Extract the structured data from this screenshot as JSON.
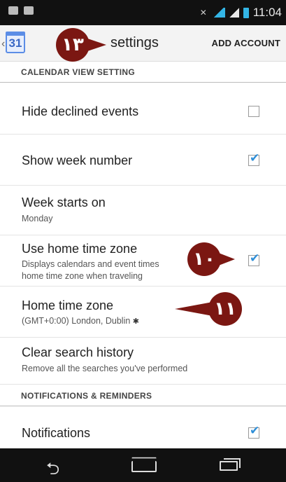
{
  "status_bar": {
    "time": "11:04"
  },
  "action_bar": {
    "app_icon_text": "31",
    "title": "settings",
    "add_account": "ADD ACCOUNT"
  },
  "sections": [
    {
      "header": "CALENDAR VIEW SETTING"
    },
    {
      "header": "NOTIFICATIONS & REMINDERS"
    }
  ],
  "rows": [
    {
      "title": "Hide declined events",
      "checked": false
    },
    {
      "title": "Show week number",
      "checked": true
    },
    {
      "title": "Week starts on",
      "subtitle": "Monday"
    },
    {
      "title": "Use home time zone",
      "subtitle_line1": "Displays calendars and event times",
      "subtitle_line2": "home time zone when traveling",
      "checked": true
    },
    {
      "title": "Home time zone",
      "subtitle": "(GMT+0:00) London, Dublin",
      "marker": "✱"
    },
    {
      "title": "Clear search history",
      "subtitle": "Remove all the searches you've performed"
    },
    {
      "title": "Notifications",
      "checked": true
    }
  ],
  "callouts": [
    {
      "label": "١٣"
    },
    {
      "label": "١٠"
    },
    {
      "label": "١١"
    }
  ],
  "icons": {
    "back": "back-icon",
    "home": "home-icon",
    "recents": "recents-icon"
  },
  "colors": {
    "callout": "#7b1712",
    "checkmark": "#2f8fd8",
    "status_bar": "#111111"
  }
}
